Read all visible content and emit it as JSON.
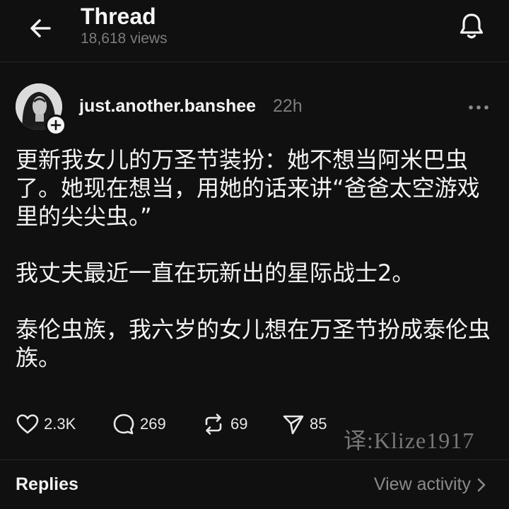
{
  "header": {
    "title": "Thread",
    "views": "18,618 views",
    "back_icon": "arrow-left-icon",
    "notify_icon": "bell-icon"
  },
  "post": {
    "username": "just.another.banshee",
    "timestamp": "22h",
    "paragraphs": [
      "更新我女儿的万圣节装扮：她不想当阿米巴虫了。她现在想当，用她的话来讲“爸爸太空游戏里的尖尖虫。”",
      "我丈夫最近一直在玩新出的星际战士2。",
      "泰伦虫族，我六岁的女儿想在万圣节扮成泰伦虫族。"
    ]
  },
  "actions": {
    "likes": "2.3K",
    "comments": "269",
    "reposts": "69",
    "shares": "85"
  },
  "watermark": "译:Klize1917",
  "footer": {
    "replies_label": "Replies",
    "view_activity_label": "View activity"
  },
  "colors": {
    "background": "#101010",
    "text_primary": "#f3f3f3",
    "text_secondary": "#7c7c7c",
    "divider": "#262626"
  }
}
